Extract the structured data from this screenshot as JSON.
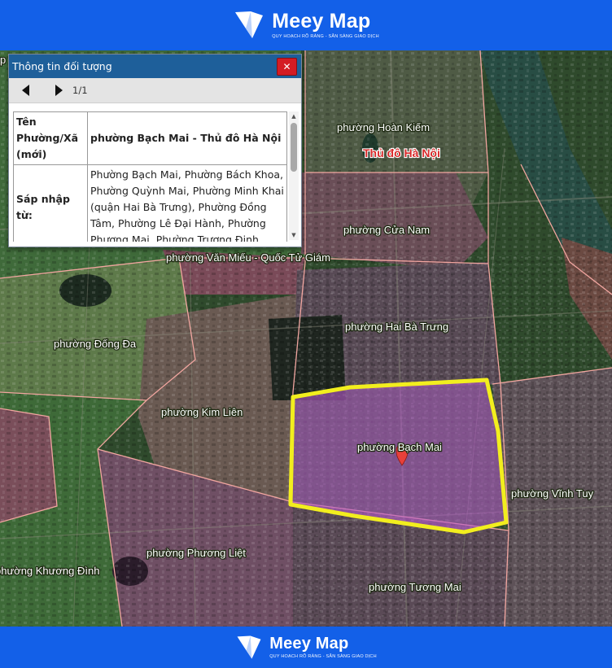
{
  "brand": {
    "name": "Meey Map",
    "tagline": "QUY HOẠCH RÕ RÀNG - SẴN SÀNG GIAO DỊCH",
    "color": "#1360e8"
  },
  "panel": {
    "title": "Thông tin đối tượng",
    "close_label": "✕",
    "pager": {
      "prev_icon": "prev-arrow-icon",
      "next_icon": "next-arrow-icon",
      "count": "1/1"
    },
    "rows": [
      {
        "key": "Tên Phường/Xã (mới)",
        "value": "phường Bạch Mai - Thủ đô Hà Nội"
      },
      {
        "key": "Sáp nhập từ:",
        "value": "Phường Bạch Mai, Phường Bách Khoa, Phường Quỳnh Mai, Phường Minh Khai (quận Hai Bà Trưng), Phường Đồng Tâm, Phường Lê Đại Hành, Phường Phương Mai, Phường Trương Định,"
      }
    ]
  },
  "map": {
    "city_label": "Thủ đô Hà Nội",
    "ward_labels": [
      "phường Hoàn Kiếm",
      "phường Cửa Nam",
      "phường Văn Miếu - Quốc Tử Giám",
      "phường Hai Bà Trưng",
      "phường Đống Đa",
      "phường Kim Liên",
      "phường Bạch Mai",
      "phường Vĩnh Tuy",
      "phường Phương Liệt",
      "phường Khương Đình",
      "phường Tương Mai",
      "p"
    ],
    "selected_ward": "phường Bạch Mai",
    "highlight_color": "#f2ee1e",
    "selection_fill": "#b45ac8",
    "marker_color": "#e8403a",
    "river_color": "#284d44"
  }
}
